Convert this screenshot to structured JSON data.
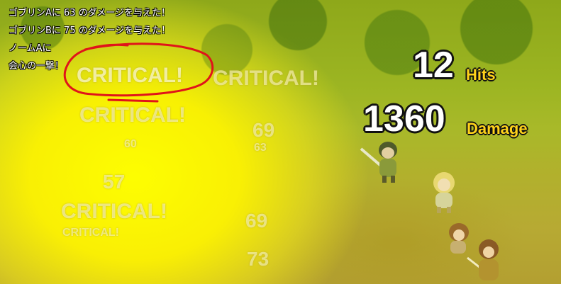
{
  "battle_log": [
    "ゴブリンAに 63 のダメージを与えた！",
    "ゴブリンBに 75 のダメージを与えた！",
    "ノームAに",
    "会心の一撃！"
  ],
  "popups": {
    "critical_1": "CRITICAL!",
    "critical_2": "CRITICAL!",
    "critical_3": "CRITICAL!",
    "critical_4": "CRITICAL!",
    "critical_5": "CRITICAL!",
    "dmg_1": "69",
    "dmg_2": "63",
    "dmg_3": "60",
    "dmg_4": "57",
    "dmg_5": "69",
    "dmg_6": "73"
  },
  "combo": {
    "hits_value": "12",
    "hits_label": "Hits",
    "damage_value": "1360",
    "damage_label": "Damage"
  },
  "colors": {
    "annotation": "#e0141a",
    "counter_label": "#ffd21a",
    "flash": "#ffff00"
  }
}
